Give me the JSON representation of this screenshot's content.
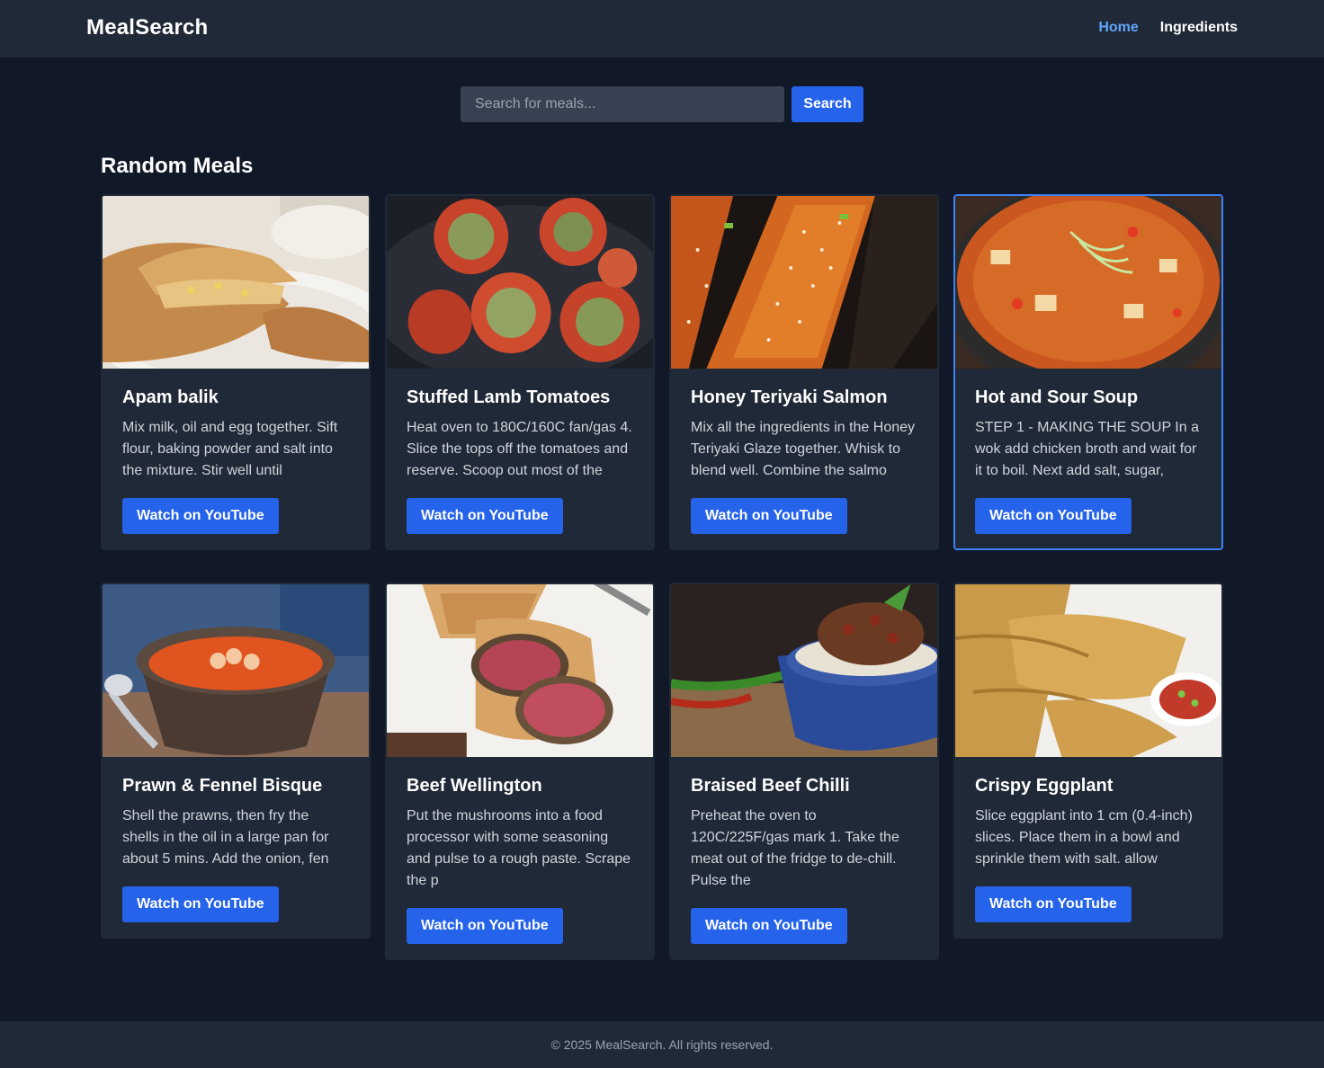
{
  "brand": "MealSearch",
  "nav": {
    "items": [
      {
        "label": "Home",
        "active": true
      },
      {
        "label": "Ingredients",
        "active": false
      }
    ]
  },
  "search": {
    "placeholder": "Search for meals...",
    "value": "",
    "button_label": "Search"
  },
  "section_title": "Random Meals",
  "meals": [
    {
      "title": "Apam balik",
      "description": "Mix milk, oil and egg together. Sift flour, baking powder and salt into the mixture. Stir well until",
      "button_label": "Watch on YouTube",
      "image": "folded-pancake"
    },
    {
      "title": "Stuffed Lamb Tomatoes",
      "description": "Heat oven to 180C/160C fan/gas 4. Slice the tops off the tomatoes and reserve. Scoop out most of the",
      "button_label": "Watch on YouTube",
      "image": "stuffed-tomatoes"
    },
    {
      "title": "Honey Teriyaki Salmon",
      "description": "Mix all the ingredients in the Honey Teriyaki Glaze together. Whisk to blend well. Combine the salmo",
      "button_label": "Watch on YouTube",
      "image": "glazed-salmon"
    },
    {
      "title": "Hot and Sour Soup",
      "description": "STEP 1 - MAKING THE SOUP In a wok add chicken broth and wait for it to boil. Next add salt, sugar,",
      "button_label": "Watch on YouTube",
      "image": "soup-bowl"
    },
    {
      "title": "Prawn & Fennel Bisque",
      "description": "Shell the prawns, then fry the shells in the oil in a large pan for about 5 mins. Add the onion, fen",
      "button_label": "Watch on YouTube",
      "image": "bisque-bowl"
    },
    {
      "title": "Beef Wellington",
      "description": "Put the mushrooms into a food processor with some seasoning and pulse to a rough paste. Scrape the p",
      "button_label": "Watch on YouTube",
      "image": "beef-wellington"
    },
    {
      "title": "Braised Beef Chilli",
      "description": "Preheat the oven to 120C/225F/gas mark 1. Take the meat out of the fridge to de-chill. Pulse the",
      "button_label": "Watch on YouTube",
      "image": "chilli-bowl"
    },
    {
      "title": "Crispy Eggplant",
      "description": "Slice eggplant into 1 cm (0.4-inch) slices. Place them in a bowl and sprinkle them with salt. allow",
      "button_label": "Watch on YouTube",
      "image": "fried-eggplant"
    }
  ],
  "footer": "© 2025 MealSearch. All rights reserved.",
  "colors": {
    "background": "#111827",
    "surface": "#1f2937",
    "accent": "#2563eb",
    "active_link": "#60a5fa",
    "focus_border": "#3b82f6"
  }
}
